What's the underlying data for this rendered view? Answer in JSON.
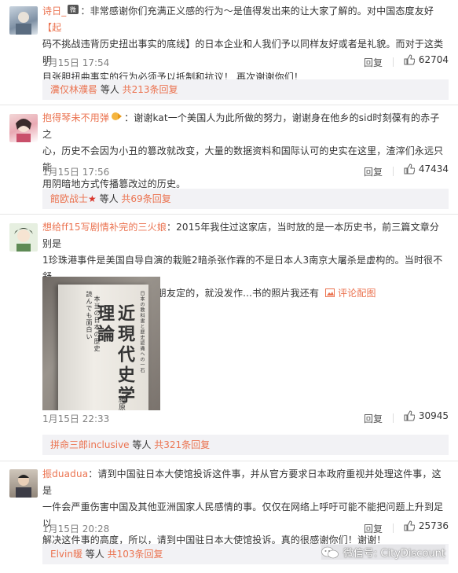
{
  "comments": [
    {
      "username": "诗日_",
      "text_lines": [
        "：非常感谢你们充满正义感的行为～是值得发出来的让大家了解的。对中国态度友好",
        "码不挑战违背历史扭出事实的底线】的日本企业和人我们予以同样友好或者是礼貌。而对于这类明",
        "目张胆扭曲事实的行为必须予以抵制和抗议！ 再次谢谢你们！"
      ],
      "highlight_open": "【起",
      "time": "1月15日 17:54",
      "reply_label": "回复",
      "likes": "62704",
      "sub_user": "瀵仅林濮晷",
      "sub_mid": " 等人 ",
      "sub_count": "共213条回复"
    },
    {
      "username": "抱得琴未不用弹",
      "text_lines": [
        "：谢谢kat一个美国人为此所做的努力，谢谢身在他乡的sid时刻葆有的赤子之",
        "心，历史不会因为小丑的篡改就改变，大量的数据资料和国际认可的史实在这里，渣滓们永远只能",
        "用阴暗地方式传播篡改过的历史。"
      ],
      "time": "1月15日 17:56",
      "reply_label": "回复",
      "likes": "47434",
      "sub_user": "館欧战士",
      "sub_mid": " 等人 ",
      "sub_count": "共69条回复"
    },
    {
      "username": "想给ff15写剧情补完的三火娘",
      "text_lines": [
        "：2015年我住过这家店，当时放的是一本历史书，前三篇文章分别是",
        "1珍珠港事件是美国自导自演的栽赃2暗杀张作霖的不是日本人3南京大屠杀是虚构的。当时很不舒",
        "服，但是不会日文，行程是朋友定的，就没发作...书的照片我还有"
      ],
      "pic_link": "评论配图",
      "book": {
        "sm1": "読んでも面白い",
        "sm2": "本当の日本の歴史",
        "big": "理論",
        "big2": "近現代史学",
        "sm3": "日本の教科書と歴史認識への一石",
        "author": "藤原"
      },
      "time": "1月15日 22:33",
      "reply_label": "回复",
      "likes": "30945",
      "sub_user": "拼命三郎inclusive",
      "sub_mid": " 等人 ",
      "sub_count": "共321条回复"
    },
    {
      "username": "振duadua",
      "text_lines": [
        "：请到中国驻日本大使馆投诉这件事，并从官方要求日本政府重视并处理这件事，这是",
        "一件会严重伤害中国及其他亚洲国家人民感情的事。仅仅在网络上呼吁可能不能把问题上升到足以",
        "解决这件事的高度，所以，请到中国驻日本大使馆投诉。真的很感谢你们！谢谢！"
      ],
      "time": "1月15日 20:28",
      "reply_label": "回复",
      "likes": "25736",
      "sub_user": "Elvin暖",
      "sub_mid": " 等人 ",
      "sub_count": "共103条回复"
    }
  ],
  "watermark": "微信号: CityDiscount",
  "colors": {
    "link": "#eb7350",
    "meta": "#808080",
    "subbar_bg": "#f2f2f5"
  }
}
